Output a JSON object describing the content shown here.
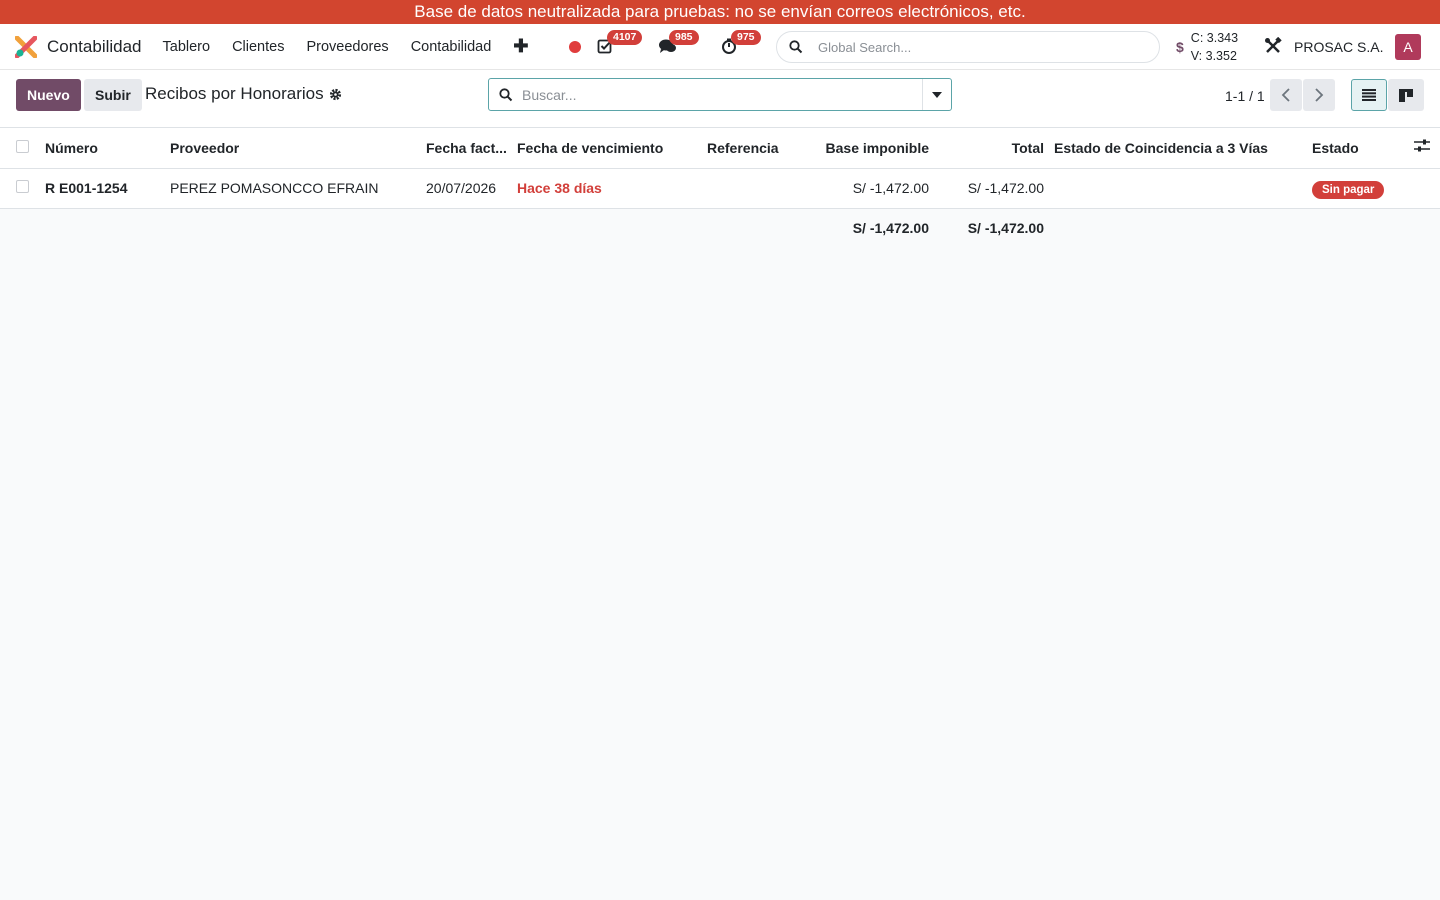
{
  "banner": "Base de datos neutralizada para pruebas: no se envían correos electrónicos, etc.",
  "app": {
    "name": "Contabilidad"
  },
  "menu": [
    "Tablero",
    "Clientes",
    "Proveedores",
    "Contabilidad"
  ],
  "systray": {
    "activities_count": "4107",
    "messages_count": "985",
    "timesheet_count": "975"
  },
  "global_search": {
    "placeholder": "Global Search..."
  },
  "rates": {
    "buy": "C: 3.343",
    "sell": "V: 3.352"
  },
  "company": "PROSAC S.A.",
  "user_initial": "A",
  "control": {
    "new_label": "Nuevo",
    "upload_label": "Subir",
    "breadcrumb": "Recibos por Honorarios",
    "search_placeholder": "Buscar...",
    "pager": "1-1 / 1"
  },
  "table": {
    "headers": [
      "Número",
      "Proveedor",
      "Fecha fact...",
      "Fecha de vencimiento",
      "Referencia",
      "Base imponible",
      "Total",
      "Estado de Coincidencia a 3 Vías",
      "Estado"
    ],
    "rows": [
      {
        "numero": "R E001-1254",
        "proveedor": "PEREZ POMASONCCO EFRAIN",
        "fecha": "20/07/2026",
        "vencimiento": "Hace 38 días",
        "referencia": "",
        "base": "S/ -1,472.00",
        "total": "S/ -1,472.00",
        "coincidencia": "",
        "estado": "Sin pagar"
      }
    ],
    "footer": {
      "base": "S/ -1,472.00",
      "total": "S/ -1,472.00"
    }
  },
  "colors": {
    "primary": "#714b67",
    "banner": "#d2452f",
    "danger": "#d23f3a"
  }
}
